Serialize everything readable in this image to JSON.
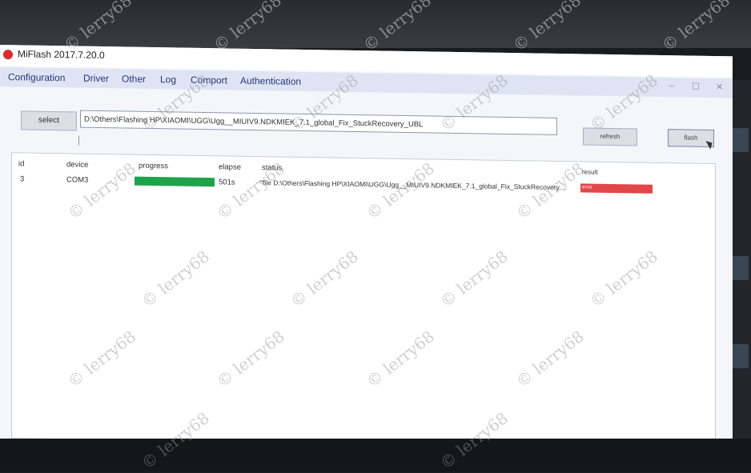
{
  "window": {
    "title": "MiFlash 2017.7.20.0",
    "controls": [
      "–",
      "☐",
      "✕"
    ]
  },
  "menu": [
    "Configuration",
    "Driver",
    "Other",
    "Log",
    "Comport",
    "Authentication"
  ],
  "toolbar": {
    "select_label": "select",
    "path_value": "D:\\Others\\Flashing HP\\XIAOMI\\UGG\\Ugg__MIUIV9.NDKMIEK_7.1_global_Fix_StuckRecovery_UBL",
    "refresh_label": "refresh",
    "flash_label": "flash"
  },
  "table": {
    "headers": [
      "id",
      "device",
      "progress",
      "elapse",
      "status",
      "result"
    ],
    "rows": [
      {
        "id": "3",
        "device": "COM3",
        "progress": 1.0,
        "elapse": "501s",
        "status": "\"file D:\\Others\\Flashing HP\\XIAOMI\\UGG\\Ugg__MIUIV9.NDKMIEK_7.1_global_Fix_StuckRecovery...",
        "result": "error"
      }
    ]
  },
  "watermark": "© lerry68",
  "colors": {
    "progress": "#1ea34a",
    "result_error": "#e0464a",
    "menubar": "#dfe3f3",
    "menu_text": "#233a7a"
  }
}
